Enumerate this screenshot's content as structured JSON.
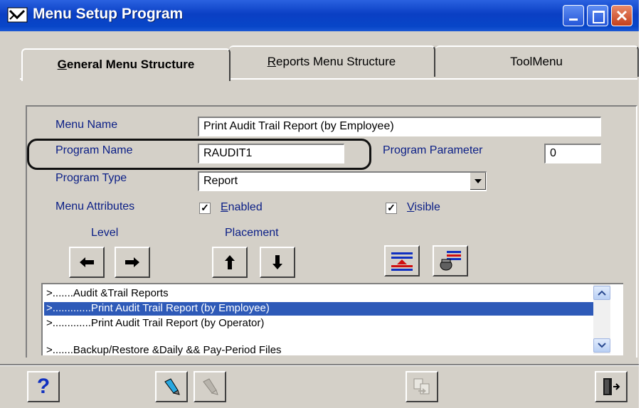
{
  "window": {
    "title": "Menu Setup Program"
  },
  "tabs": [
    {
      "label": "General Menu Structure",
      "mnemonic": "G",
      "rest": "eneral Menu Structure"
    },
    {
      "label": "Reports Menu Structure",
      "mnemonic": "R",
      "rest": "eports Menu Structure"
    },
    {
      "label": "ToolMenu"
    }
  ],
  "form": {
    "menu_name_label": "Menu Name",
    "menu_name_value": "Print Audit Trail Report (by Employee)",
    "program_name_label": "Program Name",
    "program_name_value": "RAUDIT1",
    "program_parameter_label": "Program Parameter",
    "program_parameter_value": "0",
    "program_type_label": "Program Type",
    "program_type_value": "Report",
    "menu_attributes_label": "Menu Attributes",
    "enabled": {
      "checked": true,
      "mnemonic": "E",
      "rest": "nabled",
      "label": "Enabled"
    },
    "visible": {
      "checked": true,
      "mnemonic": "V",
      "rest": "isible",
      "label": "Visible"
    },
    "level_label": "Level",
    "placement_label": "Placement"
  },
  "list_items": [
    {
      "text": ">.......Audit &Trail Reports",
      "selected": false
    },
    {
      "text": ">.............Print Audit Trail Report (by Employee)",
      "selected": true
    },
    {
      "text": ">.............Print Audit Trail Report (by Operator)",
      "selected": false
    },
    {
      "text": ">.......Backup/Restore &Daily && Pay-Period Files",
      "selected": false
    }
  ],
  "icons": {
    "level_left": "arrow-left-icon",
    "level_right": "arrow-right-icon",
    "move_up": "arrow-up-icon",
    "move_down": "arrow-down-icon",
    "insert": "insert-line-icon",
    "add_item": "add-item-icon",
    "help": "question-mark-icon",
    "flashlight_on": "flashlight-icon",
    "flashlight_off": "flashlight-disabled-icon",
    "copy": "copy-icon",
    "exit": "exit-door-icon"
  },
  "colors": {
    "titlebar": "#0a3fc4",
    "selection": "#2e5ab8",
    "label_text": "#0a1e86"
  }
}
